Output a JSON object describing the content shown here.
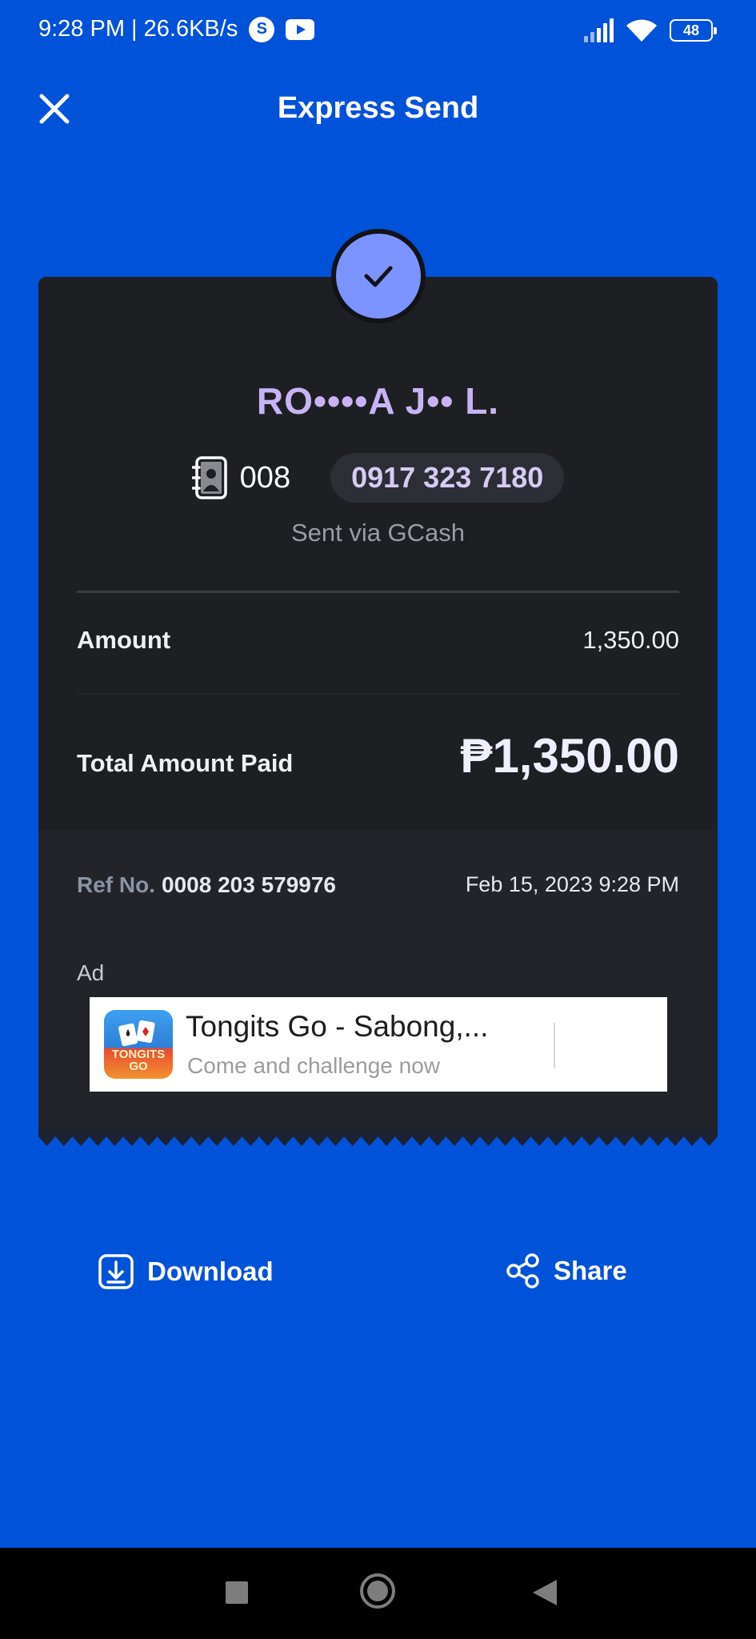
{
  "status_bar": {
    "time_speed": "9:28 PM | 26.6KB/s",
    "s_badge": "S",
    "battery": "48"
  },
  "header": {
    "title": "Express Send"
  },
  "receipt": {
    "recipient_name": "RO••••A J•• L.",
    "recipient_code": "008",
    "phone_number": "0917 323 7180",
    "sent_via": "Sent via GCash",
    "amount_label": "Amount",
    "amount_value": "1,350.00",
    "total_label": "Total Amount Paid",
    "total_value": "₱1,350.00",
    "ref_label": "Ref No.",
    "ref_value": "0008 203 579976",
    "date": "Feb 15, 2023 9:28 PM"
  },
  "ad": {
    "label": "Ad",
    "title": "Tongits Go - Sabong,...",
    "subtitle": "Come and challenge now",
    "logo_text": "TONGITS GO"
  },
  "actions": {
    "download_label": "Download",
    "share_label": "Share"
  },
  "colors": {
    "background": "#0052d9",
    "card": "#1e1f22",
    "check_badge": "#7c94ff",
    "name_accent": "#c8b4f4"
  },
  "icons": {
    "close": "close-icon",
    "check": "check-icon",
    "contact": "contact-book-icon",
    "download": "download-icon",
    "share": "share-icon"
  }
}
